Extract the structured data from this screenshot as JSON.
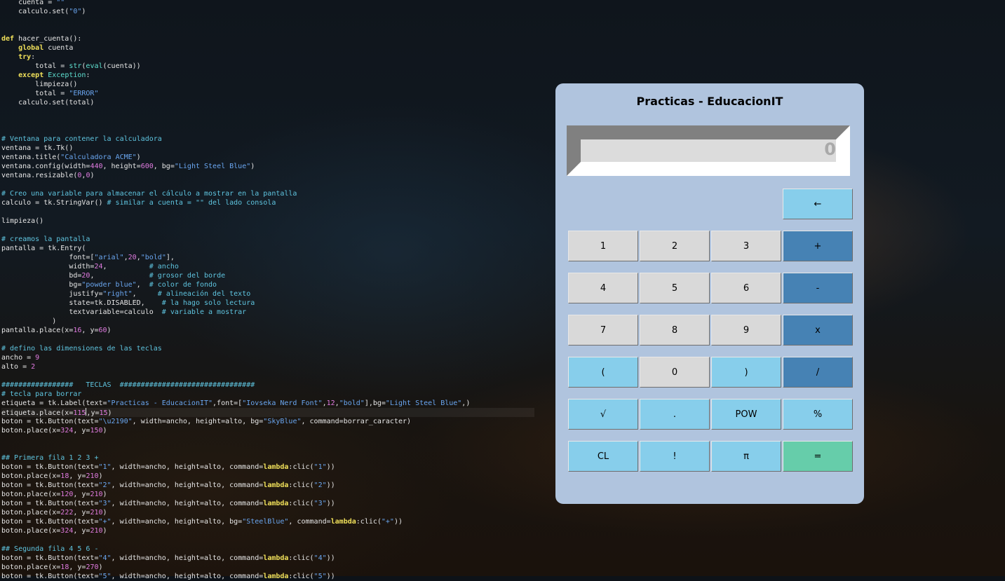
{
  "editor": {
    "lines": [
      [
        [
          "fn",
          "    cuenta = "
        ],
        [
          "st",
          "\"\""
        ]
      ],
      [
        [
          "fn",
          "    calculo.set("
        ],
        [
          "st",
          "\"0\""
        ],
        [
          "fn",
          ")"
        ]
      ],
      [],
      [],
      [
        [
          "kw",
          "def"
        ],
        [
          "fn",
          " hacer_cuenta():"
        ]
      ],
      [
        [
          "fn",
          "    "
        ],
        [
          "kw",
          "global"
        ],
        [
          "fn",
          " cuenta"
        ]
      ],
      [
        [
          "fn",
          "    "
        ],
        [
          "kw",
          "try"
        ],
        [
          "fn",
          ":"
        ]
      ],
      [
        [
          "fn",
          "        total = "
        ],
        [
          "bi",
          "str"
        ],
        [
          "fn",
          "("
        ],
        [
          "bi",
          "eval"
        ],
        [
          "fn",
          "(cuenta))"
        ]
      ],
      [
        [
          "fn",
          "    "
        ],
        [
          "kw",
          "except"
        ],
        [
          "fn",
          " "
        ],
        [
          "bi",
          "Exception"
        ],
        [
          "fn",
          ":"
        ]
      ],
      [
        [
          "fn",
          "        limpieza()"
        ]
      ],
      [
        [
          "fn",
          "        total = "
        ],
        [
          "st",
          "\"ERROR\""
        ]
      ],
      [
        [
          "fn",
          "    calculo.set(total)"
        ]
      ],
      [],
      [],
      [],
      [
        [
          "cm",
          "# Ventana para contener la calculadora"
        ]
      ],
      [
        [
          "fn",
          "ventana = tk.Tk()"
        ]
      ],
      [
        [
          "fn",
          "ventana.title("
        ],
        [
          "st",
          "\"Calculadora ACME\""
        ],
        [
          "fn",
          ")"
        ]
      ],
      [
        [
          "fn",
          "ventana.config(width="
        ],
        [
          "nm",
          "440"
        ],
        [
          "fn",
          ", height="
        ],
        [
          "nm",
          "600"
        ],
        [
          "fn",
          ", bg="
        ],
        [
          "st",
          "\"Light Steel Blue\""
        ],
        [
          "fn",
          ")"
        ]
      ],
      [
        [
          "fn",
          "ventana.resizable("
        ],
        [
          "nm",
          "0"
        ],
        [
          "fn",
          ","
        ],
        [
          "nm",
          "0"
        ],
        [
          "fn",
          ")"
        ]
      ],
      [],
      [
        [
          "cm",
          "# Creo una variable para almacenar el cálculo a mostrar en la pantalla"
        ]
      ],
      [
        [
          "fn",
          "calculo = tk.StringVar() "
        ],
        [
          "cm",
          "# similar a cuenta = \"\" del lado consola"
        ]
      ],
      [],
      [
        [
          "fn",
          "limpieza()"
        ]
      ],
      [],
      [
        [
          "cm",
          "# creamos la pantalla"
        ]
      ],
      [
        [
          "fn",
          "pantalla = tk.Entry("
        ]
      ],
      [
        [
          "fn",
          "                font=["
        ],
        [
          "st",
          "\"arial\""
        ],
        [
          "fn",
          ","
        ],
        [
          "nm",
          "20"
        ],
        [
          "fn",
          ","
        ],
        [
          "st",
          "\"bold\""
        ],
        [
          "fn",
          "],"
        ]
      ],
      [
        [
          "fn",
          "                width="
        ],
        [
          "nm",
          "24"
        ],
        [
          "fn",
          ",          "
        ],
        [
          "cm",
          "# ancho"
        ]
      ],
      [
        [
          "fn",
          "                bd="
        ],
        [
          "nm",
          "20"
        ],
        [
          "fn",
          ",             "
        ],
        [
          "cm",
          "# grosor del borde"
        ]
      ],
      [
        [
          "fn",
          "                bg="
        ],
        [
          "st",
          "\"powder blue\""
        ],
        [
          "fn",
          ",  "
        ],
        [
          "cm",
          "# color de fondo"
        ]
      ],
      [
        [
          "fn",
          "                justify="
        ],
        [
          "st",
          "\"right\""
        ],
        [
          "fn",
          ",     "
        ],
        [
          "cm",
          "# alineación del texto"
        ]
      ],
      [
        [
          "fn",
          "                state=tk.DISABLED,    "
        ],
        [
          "cm",
          "# la hago solo lectura"
        ]
      ],
      [
        [
          "fn",
          "                textvariable=calculo  "
        ],
        [
          "cm",
          "# variable a mostrar"
        ]
      ],
      [
        [
          "fn",
          "            )"
        ]
      ],
      [
        [
          "fn",
          "pantalla.place(x="
        ],
        [
          "nm",
          "16"
        ],
        [
          "fn",
          ", y="
        ],
        [
          "nm",
          "60"
        ],
        [
          "fn",
          ")"
        ]
      ],
      [],
      [
        [
          "cm",
          "# defino las dimensiones de las teclas"
        ]
      ],
      [
        [
          "fn",
          "ancho = "
        ],
        [
          "nm",
          "9"
        ]
      ],
      [
        [
          "fn",
          "alto = "
        ],
        [
          "nm",
          "2"
        ]
      ],
      [],
      [
        [
          "cm",
          "#################   TECLAS  ################################"
        ]
      ],
      [
        [
          "cm",
          "# tecla para borrar"
        ]
      ],
      [
        [
          "fn",
          "etiqueta = tk.Label(text="
        ],
        [
          "st",
          "\"Practicas - EducacionIT\""
        ],
        [
          "fn",
          ",font=["
        ],
        [
          "st",
          "\"Iovseka Nerd Font\""
        ],
        [
          "fn",
          ","
        ],
        [
          "nm",
          "12"
        ],
        [
          "fn",
          ","
        ],
        [
          "st",
          "\"bold\""
        ],
        [
          "fn",
          "],bg="
        ],
        [
          "st",
          "\"Light Steel Blue\""
        ],
        [
          "fn",
          ",)"
        ]
      ],
      [
        [
          "fn",
          "etiqueta.place(x="
        ],
        [
          "nm",
          "115"
        ],
        [
          "cur",
          ""
        ],
        [
          "fn",
          ",y="
        ],
        [
          "nm",
          "15"
        ],
        [
          "fn",
          ")"
        ]
      ],
      [
        [
          "fn",
          "boton = tk.Button(text="
        ],
        [
          "st",
          "\"\\u2190\""
        ],
        [
          "fn",
          ", width=ancho, height=alto, bg="
        ],
        [
          "st",
          "\"SkyBlue\""
        ],
        [
          "fn",
          ", command=borrar_caracter)"
        ]
      ],
      [
        [
          "fn",
          "boton.place(x="
        ],
        [
          "nm",
          "324"
        ],
        [
          "fn",
          ", y="
        ],
        [
          "nm",
          "150"
        ],
        [
          "fn",
          ")"
        ]
      ],
      [],
      [],
      [
        [
          "cm",
          "## Primera fila 1 2 3 +"
        ]
      ],
      [
        [
          "fn",
          "boton = tk.Button(text="
        ],
        [
          "st",
          "\"1\""
        ],
        [
          "fn",
          ", width=ancho, height=alto, command="
        ],
        [
          "kw",
          "lambda"
        ],
        [
          "fn",
          ":clic("
        ],
        [
          "st",
          "\"1\""
        ],
        [
          "fn",
          "))"
        ]
      ],
      [
        [
          "fn",
          "boton.place(x="
        ],
        [
          "nm",
          "18"
        ],
        [
          "fn",
          ", y="
        ],
        [
          "nm",
          "210"
        ],
        [
          "fn",
          ")"
        ]
      ],
      [
        [
          "fn",
          "boton = tk.Button(text="
        ],
        [
          "st",
          "\"2\""
        ],
        [
          "fn",
          ", width=ancho, height=alto, command="
        ],
        [
          "kw",
          "lambda"
        ],
        [
          "fn",
          ":clic("
        ],
        [
          "st",
          "\"2\""
        ],
        [
          "fn",
          "))"
        ]
      ],
      [
        [
          "fn",
          "boton.place(x="
        ],
        [
          "nm",
          "120"
        ],
        [
          "fn",
          ", y="
        ],
        [
          "nm",
          "210"
        ],
        [
          "fn",
          ")"
        ]
      ],
      [
        [
          "fn",
          "boton = tk.Button(text="
        ],
        [
          "st",
          "\"3\""
        ],
        [
          "fn",
          ", width=ancho, height=alto, command="
        ],
        [
          "kw",
          "lambda"
        ],
        [
          "fn",
          ":clic("
        ],
        [
          "st",
          "\"3\""
        ],
        [
          "fn",
          "))"
        ]
      ],
      [
        [
          "fn",
          "boton.place(x="
        ],
        [
          "nm",
          "222"
        ],
        [
          "fn",
          ", y="
        ],
        [
          "nm",
          "210"
        ],
        [
          "fn",
          ")"
        ]
      ],
      [
        [
          "fn",
          "boton = tk.Button(text="
        ],
        [
          "st",
          "\"+\""
        ],
        [
          "fn",
          ", width=ancho, height=alto, bg="
        ],
        [
          "st",
          "\"SteelBlue\""
        ],
        [
          "fn",
          ", command="
        ],
        [
          "kw",
          "lambda"
        ],
        [
          "fn",
          ":clic("
        ],
        [
          "st",
          "\"+\""
        ],
        [
          "fn",
          "))"
        ]
      ],
      [
        [
          "fn",
          "boton.place(x="
        ],
        [
          "nm",
          "324"
        ],
        [
          "fn",
          ", y="
        ],
        [
          "nm",
          "210"
        ],
        [
          "fn",
          ")"
        ]
      ],
      [],
      [
        [
          "cm",
          "## Segunda fila 4 5 6 -"
        ]
      ],
      [
        [
          "fn",
          "boton = tk.Button(text="
        ],
        [
          "st",
          "\"4\""
        ],
        [
          "fn",
          ", width=ancho, height=alto, command="
        ],
        [
          "kw",
          "lambda"
        ],
        [
          "fn",
          ":clic("
        ],
        [
          "st",
          "\"4\""
        ],
        [
          "fn",
          "))"
        ]
      ],
      [
        [
          "fn",
          "boton.place(x="
        ],
        [
          "nm",
          "18"
        ],
        [
          "fn",
          ", y="
        ],
        [
          "nm",
          "270"
        ],
        [
          "fn",
          ")"
        ]
      ],
      [
        [
          "fn",
          "boton = tk.Button(text="
        ],
        [
          "st",
          "\"5\""
        ],
        [
          "fn",
          ", width=ancho, height=alto, command="
        ],
        [
          "kw",
          "lambda"
        ],
        [
          "fn",
          ":clic("
        ],
        [
          "st",
          "\"5\""
        ],
        [
          "fn",
          "))"
        ]
      ]
    ]
  },
  "calculator": {
    "title": "Practicas - EducacionIT",
    "display_value": "0",
    "colors": {
      "window": "#b0c4de",
      "sky_blue": "#87ceeb",
      "steel_blue": "#4682b4",
      "default": "#d9d9d9",
      "equals": "#66cdaa"
    },
    "keys": [
      {
        "label": "←",
        "row": 0,
        "col": 3,
        "style": "sky",
        "name": "backspace"
      },
      {
        "label": "1",
        "row": 1,
        "col": 0,
        "style": "gray",
        "name": "1"
      },
      {
        "label": "2",
        "row": 1,
        "col": 1,
        "style": "gray",
        "name": "2"
      },
      {
        "label": "3",
        "row": 1,
        "col": 2,
        "style": "gray",
        "name": "3"
      },
      {
        "label": "+",
        "row": 1,
        "col": 3,
        "style": "steel",
        "name": "plus"
      },
      {
        "label": "4",
        "row": 2,
        "col": 0,
        "style": "gray",
        "name": "4"
      },
      {
        "label": "5",
        "row": 2,
        "col": 1,
        "style": "gray",
        "name": "5"
      },
      {
        "label": "6",
        "row": 2,
        "col": 2,
        "style": "gray",
        "name": "6"
      },
      {
        "label": "-",
        "row": 2,
        "col": 3,
        "style": "steel",
        "name": "minus"
      },
      {
        "label": "7",
        "row": 3,
        "col": 0,
        "style": "gray",
        "name": "7"
      },
      {
        "label": "8",
        "row": 3,
        "col": 1,
        "style": "gray",
        "name": "8"
      },
      {
        "label": "9",
        "row": 3,
        "col": 2,
        "style": "gray",
        "name": "9"
      },
      {
        "label": "x",
        "row": 3,
        "col": 3,
        "style": "steel",
        "name": "multiply"
      },
      {
        "label": "(",
        "row": 4,
        "col": 0,
        "style": "sky",
        "name": "open-paren"
      },
      {
        "label": "0",
        "row": 4,
        "col": 1,
        "style": "gray",
        "name": "0"
      },
      {
        "label": ")",
        "row": 4,
        "col": 2,
        "style": "sky",
        "name": "close-paren"
      },
      {
        "label": "/",
        "row": 4,
        "col": 3,
        "style": "steel",
        "name": "divide"
      },
      {
        "label": "√",
        "row": 5,
        "col": 0,
        "style": "sky",
        "name": "sqrt"
      },
      {
        "label": ".",
        "row": 5,
        "col": 1,
        "style": "sky",
        "name": "decimal"
      },
      {
        "label": "POW",
        "row": 5,
        "col": 2,
        "style": "sky",
        "name": "pow"
      },
      {
        "label": "%",
        "row": 5,
        "col": 3,
        "style": "sky",
        "name": "percent"
      },
      {
        "label": "CL",
        "row": 6,
        "col": 0,
        "style": "sky",
        "name": "clear"
      },
      {
        "label": "!",
        "row": 6,
        "col": 1,
        "style": "sky",
        "name": "factorial"
      },
      {
        "label": "π",
        "row": 6,
        "col": 2,
        "style": "sky",
        "name": "pi"
      },
      {
        "label": "=",
        "row": 6,
        "col": 3,
        "style": "green",
        "name": "equals"
      }
    ]
  }
}
